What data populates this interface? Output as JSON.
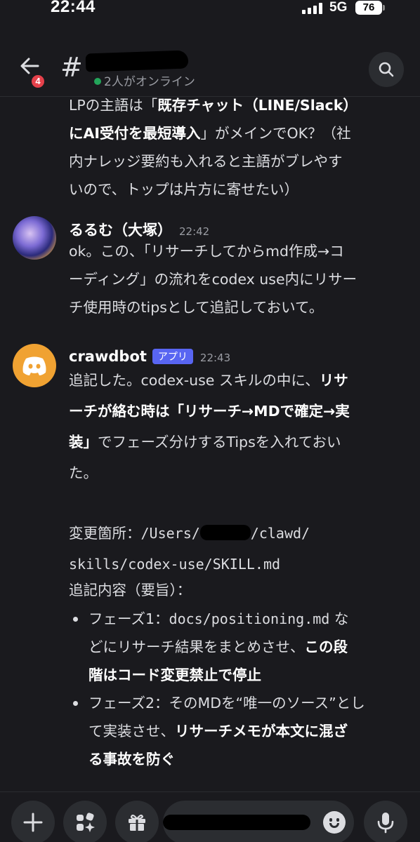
{
  "status_bar": {
    "time": "22:44",
    "network": "5G",
    "battery": "76"
  },
  "header": {
    "unread_badge": "4",
    "channel_icon": "#",
    "online_status": "2人がオンライン"
  },
  "messages": {
    "continuation": {
      "lines": [
        [
          "LPの主語は「",
          "既存チャット（LINE/Slack）"
        ],
        [
          "にAI受付を最短導入",
          "」がメインでOK？（社"
        ],
        [
          "内ナレッジ要約も入れると主語がブレやす"
        ],
        [
          "いので、トップは片方に寄せたい）"
        ]
      ]
    },
    "msg1": {
      "author": "るるむ（大塚）",
      "time": "22:42",
      "lines": [
        "ok。この、「リサーチしてからmd作成→コ",
        "ーディング」の流れをcodex use内にリサー",
        "チ使用時のtipsとして追記しておいて。"
      ]
    },
    "msg2": {
      "author": "crawdbot",
      "app_tag": "アプリ",
      "time": "22:43",
      "p1_a": "追記した。codex-use スキルの中に、",
      "p1_b1": "リサ",
      "p1_b2": "ーチが絡む時は「リサーチ→MDで確定→実",
      "p1_b3": "装」",
      "p1_c": "でフェーズ分けするTipsを入れておい",
      "p1_d": "た。",
      "changed_label": "変更箇所：",
      "path_a": "/Users/",
      "path_b": "/clawd/",
      "path_c": "skills/codex-use/SKILL.md",
      "summary_label": "追記内容（要旨）：",
      "bullet1": {
        "a": "フェーズ1：",
        "code": "docs/positioning.md",
        "b": " な",
        "c": "どにリサーチ結果をまとめさせ、",
        "bold1": "この段",
        "bold2": "階はコード変更禁止で停止"
      },
      "bullet2": {
        "a": "フェーズ2：そのMDを“唯一のソース”とし",
        "b": "て実装させ、",
        "bold1": "リサーチメモが本文に混ざ",
        "bold2": "る事故を防ぐ"
      }
    }
  },
  "colors": {
    "background": "#1a1a1e",
    "online": "#23a55a",
    "app_tag": "#5865f2",
    "badge": "#e5414b",
    "bot_avatar": "#f0a232"
  },
  "icons": [
    "back-arrow-icon",
    "hash-icon",
    "search-icon",
    "plus-icon",
    "apps-icon",
    "gift-icon",
    "emoji-icon",
    "microphone-icon",
    "discord-logo-icon"
  ]
}
